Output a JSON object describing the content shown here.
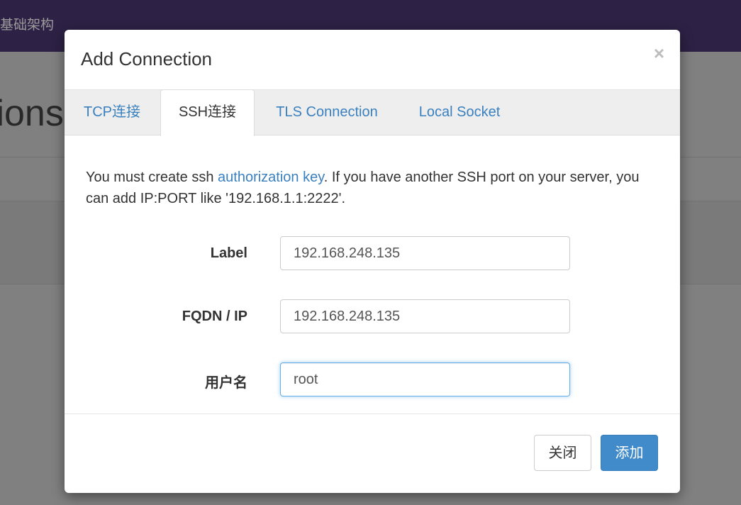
{
  "background": {
    "brand": "基础架构",
    "heading": "tions"
  },
  "modal": {
    "title": "Add Connection",
    "close_label": "×",
    "tabs": [
      {
        "label": "TCP连接",
        "active": false
      },
      {
        "label": "SSH连接",
        "active": true
      },
      {
        "label": "TLS Connection",
        "active": false
      },
      {
        "label": "Local Socket",
        "active": false
      }
    ],
    "info": {
      "part1": "You must create ssh ",
      "link": "authorization key",
      "part2": ". If you have another SSH port on your server, you can add IP:PORT like '192.168.1.1:2222'."
    },
    "fields": {
      "label": {
        "label": "Label",
        "value": "192.168.248.135"
      },
      "fqdn": {
        "label": "FQDN / IP",
        "value": "192.168.248.135"
      },
      "username": {
        "label": "用户名",
        "value": "root"
      }
    },
    "buttons": {
      "close": "关闭",
      "add": "添加"
    }
  },
  "colors": {
    "navbar": "#2d2145",
    "link": "#3a80bf",
    "primary": "#428bca",
    "focus": "#66afe9"
  }
}
